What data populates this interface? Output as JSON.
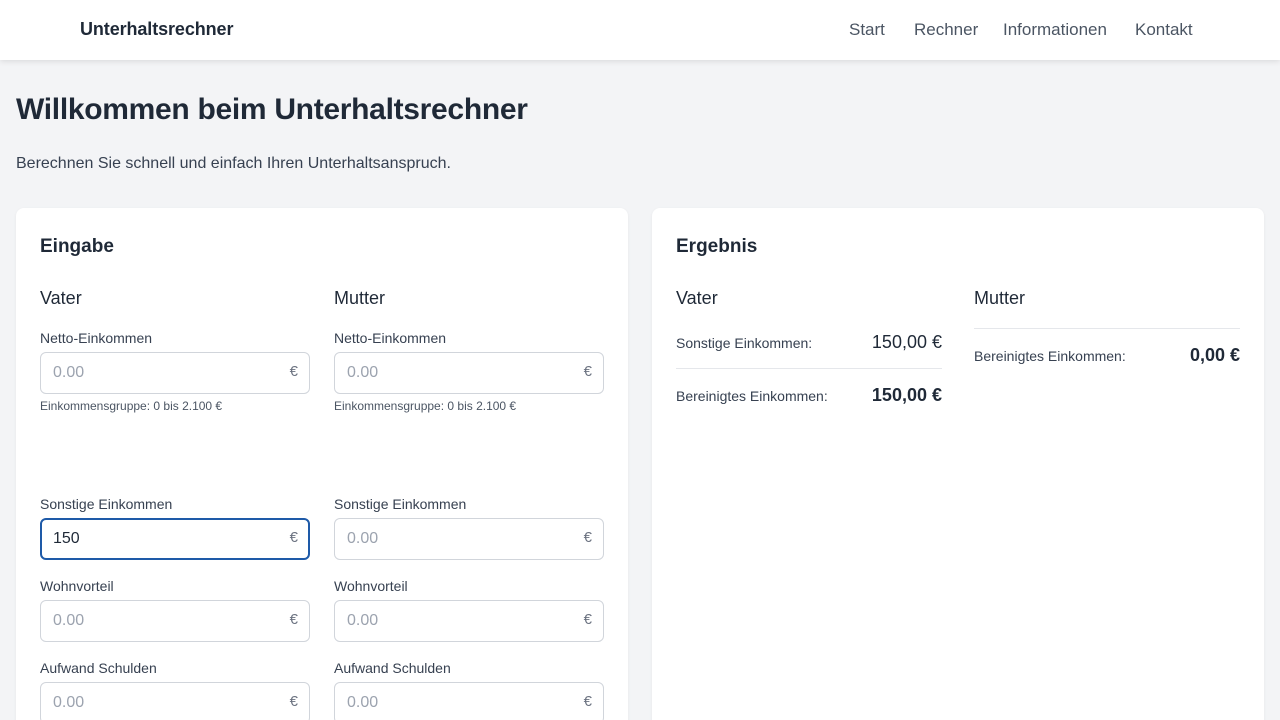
{
  "header": {
    "brand": "Unterhaltsrechner",
    "nav": [
      "Start",
      "Rechner",
      "Informationen",
      "Kontakt"
    ]
  },
  "page": {
    "title": "Willkommen beim Unterhaltsrechner",
    "subtitle": "Berechnen Sie schnell und einfach Ihren Unterhaltsanspruch."
  },
  "input_card": {
    "title": "Eingabe",
    "vater": {
      "heading": "Vater",
      "netto_label": "Netto-Einkommen",
      "netto_value": "",
      "netto_placeholder": "0.00",
      "netto_hint": "Einkommensgruppe: 0 bis 2.100 €",
      "sonstige_label": "Sonstige Einkommen",
      "sonstige_value": "150",
      "sonstige_placeholder": "0.00",
      "wohn_label": "Wohnvorteil",
      "wohn_value": "",
      "wohn_placeholder": "0.00",
      "schulden_label": "Aufwand Schulden",
      "schulden_value": "",
      "schulden_placeholder": "0.00",
      "currency": "€"
    },
    "mutter": {
      "heading": "Mutter",
      "netto_label": "Netto-Einkommen",
      "netto_value": "",
      "netto_placeholder": "0.00",
      "netto_hint": "Einkommensgruppe: 0 bis 2.100 €",
      "sonstige_label": "Sonstige Einkommen",
      "sonstige_value": "",
      "sonstige_placeholder": "0.00",
      "wohn_label": "Wohnvorteil",
      "wohn_value": "",
      "wohn_placeholder": "0.00",
      "schulden_label": "Aufwand Schulden",
      "schulden_value": "",
      "schulden_placeholder": "0.00",
      "currency": "€"
    }
  },
  "result_card": {
    "title": "Ergebnis",
    "vater": {
      "heading": "Vater",
      "rows": [
        {
          "label": "Sonstige Einkommen:",
          "value": "150,00 €"
        },
        {
          "label": "Bereinigtes Einkommen:",
          "value": "150,00 €"
        }
      ]
    },
    "mutter": {
      "heading": "Mutter",
      "rows": [
        {
          "label": "Bereinigtes Einkommen:",
          "value": "0,00 €"
        }
      ]
    }
  }
}
